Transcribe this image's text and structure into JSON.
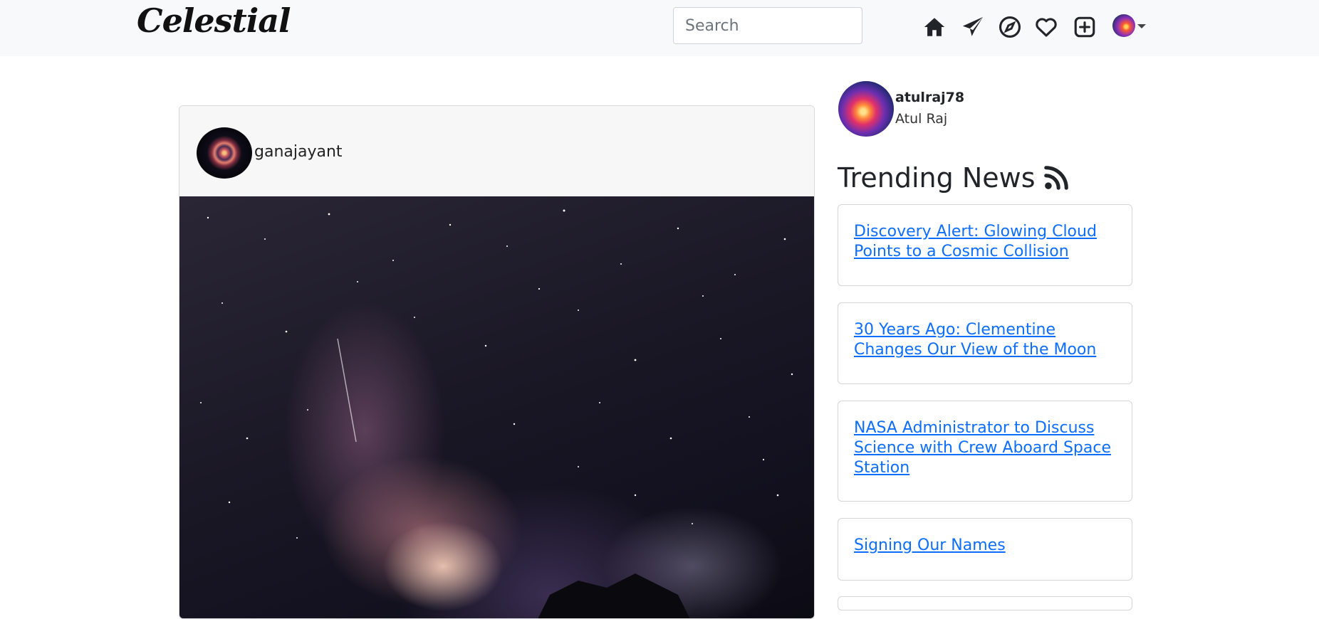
{
  "navbar": {
    "brand": "Celestial",
    "search_placeholder": "Search",
    "icons": [
      "home-icon",
      "send-icon",
      "explore-icon",
      "heart-icon",
      "add-post-icon"
    ]
  },
  "post": {
    "username": "ganajayant"
  },
  "profile": {
    "username": "atulraj78",
    "full_name": "Atul Raj"
  },
  "trending": {
    "title": "Trending News",
    "items": [
      {
        "label": "Discovery Alert: Glowing Cloud Points to a Cosmic Collision"
      },
      {
        "label": "30 Years Ago: Clementine Changes Our View of the Moon"
      },
      {
        "label": "NASA Administrator to Discuss Science with Crew Aboard Space Station"
      },
      {
        "label": "Signing Our Names"
      }
    ]
  },
  "colors": {
    "navbar_bg": "#f8f9fa",
    "link": "#0d6efd"
  }
}
